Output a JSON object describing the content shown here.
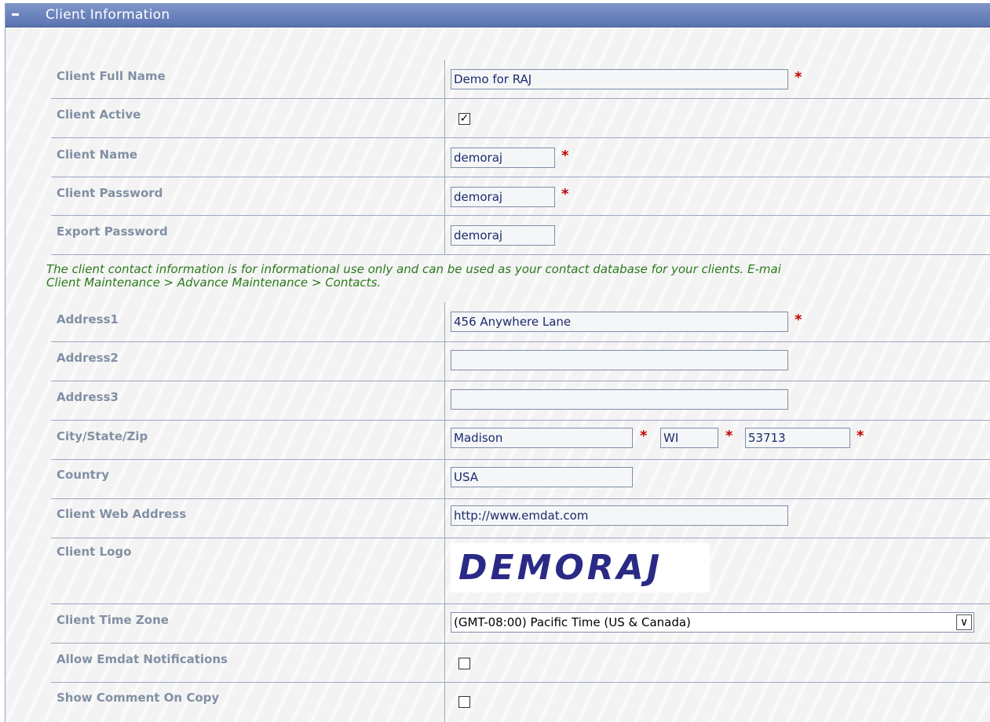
{
  "section": {
    "title": "Client Information",
    "collapse_icon": "minus-icon"
  },
  "fields": {
    "client_full_name": {
      "label": "Client Full Name",
      "value": "Demo for RAJ",
      "required": "*"
    },
    "client_active": {
      "label": "Client Active",
      "checked": "✓"
    },
    "client_name": {
      "label": "Client Name",
      "value": "demoraj",
      "required": "*"
    },
    "client_password": {
      "label": "Client Password",
      "value": "demoraj",
      "required": "*"
    },
    "export_password": {
      "label": "Export Password",
      "value": "demoraj"
    },
    "address1": {
      "label": "Address1",
      "value": "456 Anywhere Lane",
      "required": "*"
    },
    "address2": {
      "label": "Address2",
      "value": ""
    },
    "address3": {
      "label": "Address3",
      "value": ""
    },
    "city_state_zip": {
      "label": "City/State/Zip",
      "city": "Madison",
      "state": "WI",
      "zip": "53713",
      "required": "*"
    },
    "country": {
      "label": "Country",
      "value": "USA"
    },
    "client_web_address": {
      "label": "Client Web Address",
      "value": "http://www.emdat.com"
    },
    "client_logo": {
      "label": "Client Logo",
      "logo_text": "DEMORAJ"
    },
    "client_time_zone": {
      "label": "Client Time Zone",
      "selected": "(GMT-08:00) Pacific Time (US & Canada)"
    },
    "allow_emdat_notifications": {
      "label": "Allow Emdat Notifications"
    },
    "show_comment_on_copy": {
      "label": "Show Comment On Copy"
    }
  },
  "contact_note": {
    "line1": "The client contact information is for informational use only and can be used as your contact database for your clients. E-mai",
    "line2": "Client Maintenance > Advance Maintenance > Contacts."
  },
  "colors": {
    "header": "#6a82bd",
    "label": "#8290a4",
    "note": "#2b7a1c",
    "required": "#c00000",
    "logo": "#2a2a86"
  }
}
